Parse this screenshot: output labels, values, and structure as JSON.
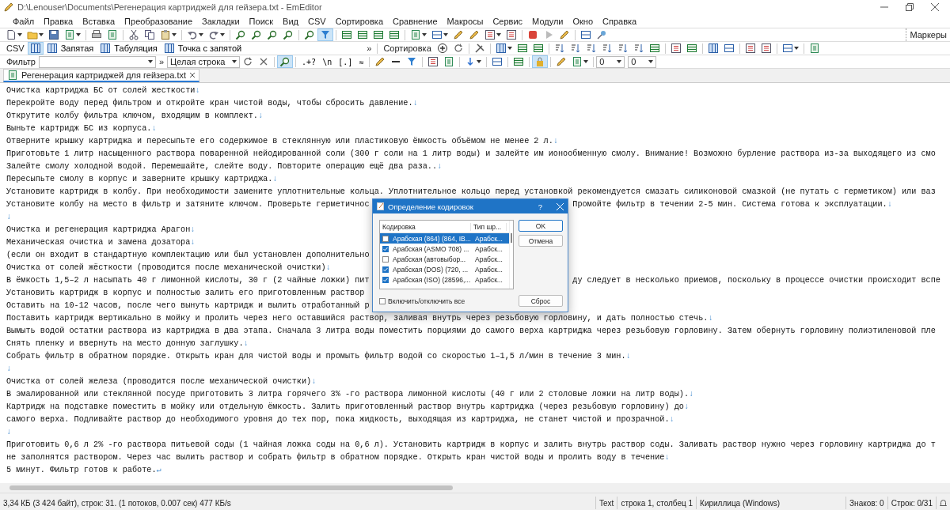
{
  "window": {
    "title": "D:\\Lenouser\\Documents\\Регенерация картриджей для гейзера.txt - EmEditor"
  },
  "menu": [
    "Файл",
    "Правка",
    "Вставка",
    "Преобразование",
    "Закладки",
    "Поиск",
    "Вид",
    "CSV",
    "Сортировка",
    "Сравнение",
    "Макросы",
    "Сервис",
    "Модули",
    "Окно",
    "Справка"
  ],
  "main_toolbar": {
    "buttons": [
      {
        "on": false
      },
      {
        "on": false
      },
      {
        "on": false
      },
      {
        "on": false
      },
      {
        "on": false
      },
      {
        "on": false
      },
      {
        "on": false
      },
      {
        "on": false
      },
      {
        "on": false
      },
      {
        "on": false
      },
      {
        "on": false
      },
      {
        "on": false
      },
      {
        "on": false
      },
      {
        "on": false
      },
      {
        "on": false
      },
      {
        "on": false
      },
      {
        "on": true
      },
      {
        "on": false
      },
      {
        "on": false
      },
      {
        "on": false
      },
      {
        "on": false
      },
      {
        "on": false
      },
      {
        "on": false
      },
      {
        "on": false
      },
      {
        "on": false
      },
      {
        "on": false
      },
      {
        "on": false
      },
      {
        "on": false
      },
      {
        "on": false
      },
      {
        "on": false
      },
      {
        "on": false
      },
      {
        "on": false
      }
    ],
    "markers_label": "Маркеры"
  },
  "csv_toolbar": {
    "label": "CSV",
    "grid_toggle": {
      "on": true
    },
    "buttons": [
      {
        "label": "Запятая"
      },
      {
        "label": "Табуляция"
      },
      {
        "label": "Точка с запятой"
      }
    ],
    "overflow": "»",
    "sort_label": "Сортировка",
    "tools": [
      {
        "on": false
      },
      {
        "on": false
      },
      {
        "on": false
      },
      {
        "on": false
      },
      {
        "on": false
      },
      {
        "on": false
      },
      {
        "on": false
      },
      {
        "on": false
      },
      {
        "on": false
      },
      {
        "on": false
      },
      {
        "on": false
      },
      {
        "on": false
      },
      {
        "on": false
      },
      {
        "on": false
      },
      {
        "on": false
      },
      {
        "on": false
      },
      {
        "on": false
      },
      {
        "on": false
      },
      {
        "on": false
      },
      {
        "on": false
      },
      {
        "on": false
      }
    ]
  },
  "filter_toolbar": {
    "label": "Фильтр",
    "overflow": "»",
    "scope": "Целая строка",
    "tools": [
      {
        "on": false
      },
      {
        "on": false
      },
      {
        "on": true
      },
      {
        "glyph": ".+?",
        "on": false
      },
      {
        "glyph": "\\n",
        "on": false
      },
      {
        "glyph": "[.]",
        "on": false
      },
      {
        "glyph": "≈",
        "on": false
      },
      {
        "on": false
      },
      {
        "on": false
      },
      {
        "on": false
      },
      {
        "on": false
      },
      {
        "on": false
      },
      {
        "on": false
      },
      {
        "on": false
      },
      {
        "on": false
      },
      {
        "on": true
      },
      {
        "on": false
      },
      {
        "on": false
      }
    ],
    "counters": [
      "0",
      "0"
    ]
  },
  "tabs": [
    {
      "label": "Регенерация картриджей для гейзера.txt",
      "selected": true
    }
  ],
  "editor": {
    "lines": [
      {
        "text": "Очистка картриджа БС от солей жесткости",
        "eol": "↓"
      },
      {
        "text": "Перекройте воду перед фильтром и откройте кран чистой воды, чтобы сбросить давление.",
        "eol": "↓"
      },
      {
        "text": "Открутите колбу фильтра ключом, входящим в комплект.",
        "eol": "↓"
      },
      {
        "text": "Выньте картридж БС из корпуса.",
        "eol": "↓"
      },
      {
        "text": "Отверните крышку картриджа и пересыпьте его содержимое в стеклянную или пластиковую ёмкость объёмом не менее 2 л.",
        "eol": "↓"
      },
      {
        "text": "Приготовьте 1 литр насыщенного раствора поваренной нейодированной соли (300 г соли на 1 литр воды) и залейте им ионообменную смолу. Внимание! Возможно бурление раствора из-за выходящего из смо"
      },
      {
        "text": "Залейте смолу холодной водой. Перемешайте, слейте воду. Повторите операцию ещё два раза..",
        "eol": "↓"
      },
      {
        "text": "Пересыпьте смолу в корпус и заверните крышку картриджа.",
        "eol": "↓"
      },
      {
        "text": "Установите картридж в колбу. При необходимости замените уплотнительные кольца. Уплотнительное кольцо перед установкой рекомендуется смазать силиконовой смазкой (не путать с герметиком) или ваз"
      },
      {
        "text": "Установите колбу на место в фильтр и затяните ключом. Проверьте герметичнос",
        "right": "Промойте фильтр в течении 2-5 мин. Система готова к эксплуатации.",
        "eol": "↓"
      },
      {
        "eol": "↓"
      },
      {
        "text": "Очистка и регенерация картриджа Арагон",
        "eol": "↓"
      },
      {
        "text": "Механическая очистка и замена дозатора",
        "eol": "↓"
      },
      {
        "text": "(если он входит в стандартную комплектацию или был установлен дополнительно"
      },
      {
        "text": "Очистка от солей жёсткости (проводится после механической очистки)",
        "eol": "↓"
      },
      {
        "text": "В ёмкость 1,5–2 л насыпать 40 г лимонной кислоты, 30 г (2 чайные ложки) пит",
        "right": "ду следует в несколько приемов, поскольку в процессе очистки происходит вспе"
      },
      {
        "text": "Установить картридж в корпус и полностью залить его приготовленным раствор"
      },
      {
        "text": "Оставить на 10-12 часов, после чего вынуть картридж и вылить отработанный р"
      },
      {
        "text": "Поставить картридж вертикально в мойку и пролить через него оставшийся раствор, заливая внутрь через резьбовую горловину, и дать полностью стечь.",
        "eol": "↓"
      },
      {
        "text": "Вымыть водой остатки раствора из картриджа в два этапа. Сначала 3 литра воды поместить порциями до самого верха картриджа через резьбовую горловину. Затем обернуть горловину полиэтиленовой пле"
      },
      {
        "text": "Снять пленку и ввернуть на место донную заглушку.",
        "eol": "↓"
      },
      {
        "text": "Собрать фильтр в обратном порядке. Открыть кран для чистой воды и промыть фильтр водой со скоростью 1–1,5 л/мин в течение 3 мин.",
        "eol": "↓"
      },
      {
        "eol": "↓"
      },
      {
        "text": "Очистка от солей железа (проводится после механической очистки)",
        "eol": "↓"
      },
      {
        "text": "В эмалированной или стеклянной посуде приготовить 3 литра горячего 3% -го раствора лимонной кислоты (40 г или 2 столовые ложки на литр воды).",
        "eol": "↓"
      },
      {
        "text": "Картридж на подставке поместить в мойку или отдельную ёмкость. Залить приготовленный раствор внутрь картриджа (через резьбовую горловину) до",
        "eol": "↓"
      },
      {
        "text": "самого верха. Подливайте раствор до необходимого уровня до тех пор, пока жидкость, выходящая из картриджа, не станет чистой и прозрачной.",
        "eol": "↓"
      },
      {
        "eol": "↓"
      },
      {
        "text": "Приготовить 0,6 л 2% -го раствора питьевой соды (1 чайная ложка соды на 0,6 л). Установить картридж в корпус и залить внутрь раствор соды. Заливать раствор нужно через горловину картриджа до т"
      },
      {
        "text": "не заполнятся раствором. Через час вылить раствор и собрать фильтр в обратном порядке. Открыть кран чистой воды и пролить воду в течение",
        "eol": "↓"
      },
      {
        "text": "5 минут. Фильтр готов к работе.",
        "eol": "↵"
      }
    ]
  },
  "dialog": {
    "title": "Определение кодировок",
    "help": "?",
    "columns": [
      "Кодировка",
      "Тип шр..."
    ],
    "rows": [
      {
        "name": "Арабская (864) (864, IB...",
        "type": "Арабск...",
        "checked": false,
        "selected": true
      },
      {
        "name": "Арабская (ASMO 708) ...",
        "type": "Арабск...",
        "checked": true,
        "selected": false
      },
      {
        "name": "Арабская (автовыбор...",
        "type": "Арабск...",
        "checked": false,
        "selected": false
      },
      {
        "name": "Арабская (DOS) (720, ...",
        "type": "Арабск...",
        "checked": true,
        "selected": false
      },
      {
        "name": "Арабская (ISO) (28596,...",
        "type": "Арабск...",
        "checked": true,
        "selected": false
      }
    ],
    "toggle_all": {
      "label": "Включить/отключить все",
      "checked": false
    },
    "ok": "OK",
    "cancel": "Отмена",
    "reset": "Сброс"
  },
  "status_bar": {
    "info": "3,34 КБ (3 424 байт), строк: 31. (1 потоков, 0.007 сек) 477 КБ/s",
    "mode": "Text",
    "position": "строка 1, столбец 1",
    "encoding": "Кириллица (Windows)",
    "chars": "Знаков: 0",
    "lines": "Строк: 0/31"
  }
}
